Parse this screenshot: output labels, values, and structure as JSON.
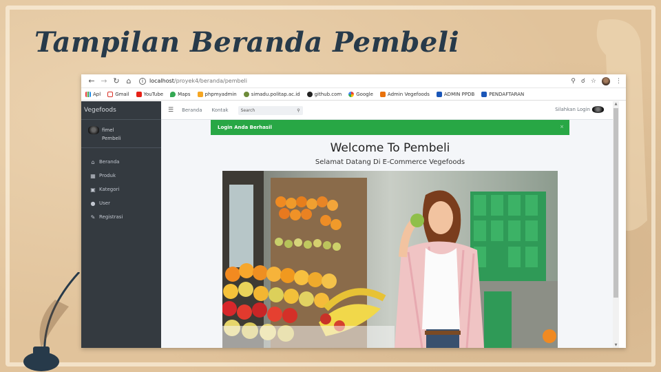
{
  "slide": {
    "title": "Tampilan Beranda Pembeli"
  },
  "browser": {
    "url_host": "localhost",
    "url_path": "/proyek4/beranda/pembeli",
    "bookmarks": [
      "Apl",
      "Gmail",
      "YouTube",
      "Maps",
      "phpmyadmin",
      "simadu.politap.ac.id",
      "github.com",
      "Google",
      "Admin Vegefoods",
      "ADMIN PPDB",
      "PENDAFTARAN"
    ]
  },
  "app": {
    "brand": "Vegefoods",
    "user": {
      "name": "fimel",
      "role": "Pembeli"
    },
    "menu": [
      {
        "label": "Beranda",
        "icon": "home-icon"
      },
      {
        "label": "Produk",
        "icon": "calendar-icon"
      },
      {
        "label": "Kategori",
        "icon": "image-icon"
      },
      {
        "label": "User",
        "icon": "user-icon"
      },
      {
        "label": "Registrasi",
        "icon": "edit-icon"
      }
    ],
    "topnav": {
      "links": [
        "Beranda",
        "Kontak"
      ],
      "search_placeholder": "Search",
      "login_text": "Silahkan Login"
    },
    "alert": "Login Anda Berhasil",
    "welcome": "Welcome To Pembeli",
    "subtitle": "Selamat Datang Di E-Commerce Vegefoods",
    "hero_image": "woman-eating-apple-grocery-photo"
  },
  "colors": {
    "sidebar": "#343a40",
    "alert": "#28a745",
    "title": "#273a4a",
    "background": "#e1c39b"
  }
}
